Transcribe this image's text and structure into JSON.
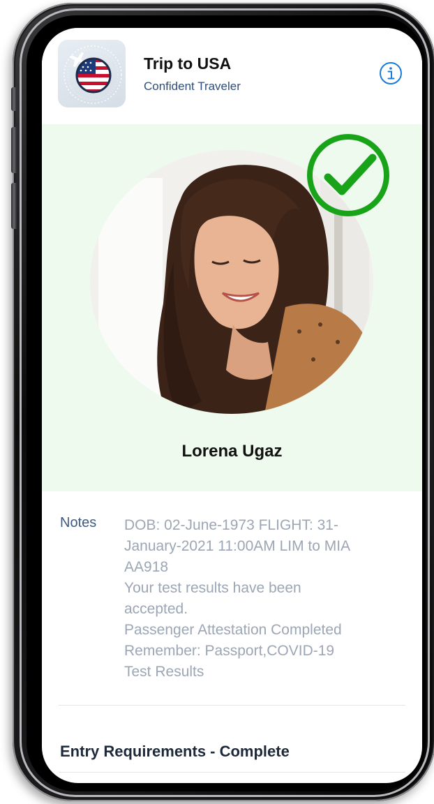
{
  "colors": {
    "accent": "#1a7ad9",
    "success": "#19a319",
    "profile_background": "#eefaee",
    "notes_text": "#9ca6b4"
  },
  "header": {
    "app_icon": "us-flag-plane-icon",
    "title": "Trip to USA",
    "subtitle": "Confident Traveler",
    "info_icon": "info-icon"
  },
  "profile": {
    "photo": "traveler-photo",
    "status_icon": "checkmark-icon",
    "name": "Lorena Ugaz"
  },
  "notes": {
    "label": "Notes",
    "lines": [
      "DOB: 02-June-1973 FLIGHT: 31-",
      "January-2021 11:00AM LIM to MIA",
      "AA918",
      "Your test results have been",
      "accepted.",
      "Passenger Attestation Completed",
      "Remember: Passport,COVID-19",
      "Test Results"
    ]
  },
  "entry_requirements": {
    "label": "Entry Requirements - Complete"
  }
}
